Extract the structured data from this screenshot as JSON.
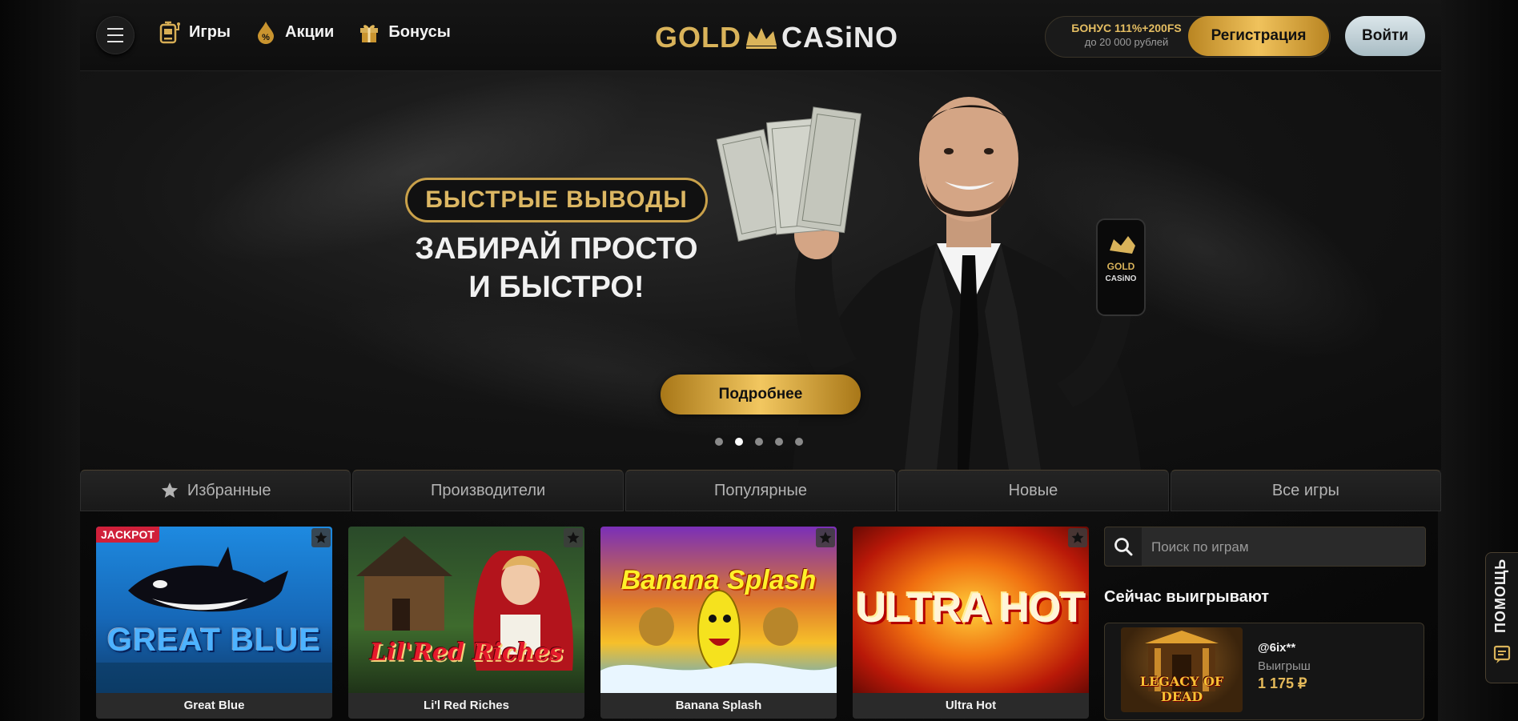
{
  "header": {
    "menu_icon": "hamburger-icon",
    "nav": [
      {
        "label": "Игры",
        "icon": "slot-machine-icon"
      },
      {
        "label": "Акции",
        "icon": "percent-drop-icon"
      },
      {
        "label": "Бонусы",
        "icon": "gift-icon"
      }
    ],
    "logo": {
      "left": "GOLD",
      "right": "CASiNO",
      "icon": "crown-icon"
    },
    "bonus": {
      "main": "БОНУС 111%+200FS",
      "sub": "до 20 000 рублей"
    },
    "register_label": "Регистрация",
    "login_label": "Войти"
  },
  "hero": {
    "badge": "БЫСТРЫЕ ВЫВОДЫ",
    "title_line1": "ЗАБИРАЙ ПРОСТО",
    "title_line2": "И БЫСТРО!",
    "phone_logo": "GOLD CASiNO",
    "button_label": "Подробнее",
    "slides_count": 5,
    "active_slide": 2
  },
  "tabs": [
    {
      "label": "Избранные",
      "icon": "star-icon"
    },
    {
      "label": "Производители"
    },
    {
      "label": "Популярные"
    },
    {
      "label": "Новые"
    },
    {
      "label": "Все игры"
    }
  ],
  "games": [
    {
      "name": "Great Blue",
      "badge": "JACKPOT",
      "art_text": "GREAT BLUE",
      "icon": "favorite-star-icon"
    },
    {
      "name": "Li'l Red Riches",
      "art_text": "Lil'Red Riches",
      "icon": "favorite-star-icon"
    },
    {
      "name": "Banana Splash",
      "art_text": "Banana Splash",
      "icon": "favorite-star-icon"
    },
    {
      "name": "Ultra Hot",
      "art_text": "ULTRA HOT",
      "icon": "favorite-star-icon"
    }
  ],
  "search": {
    "placeholder": "Поиск по играм",
    "icon": "search-icon"
  },
  "winning": {
    "title": "Сейчас выигрывают",
    "user": "@6ix**",
    "label": "Выигрыш",
    "amount": "1 175 ₽",
    "game_art_text": "LEGACY OF DEAD"
  },
  "help": {
    "label": "ПОМОЩЬ",
    "icon": "chat-icon"
  },
  "colors": {
    "accent_gold": "#e4b95a",
    "jackpot_red": "#d0203a",
    "background": "#0b0b0b"
  }
}
